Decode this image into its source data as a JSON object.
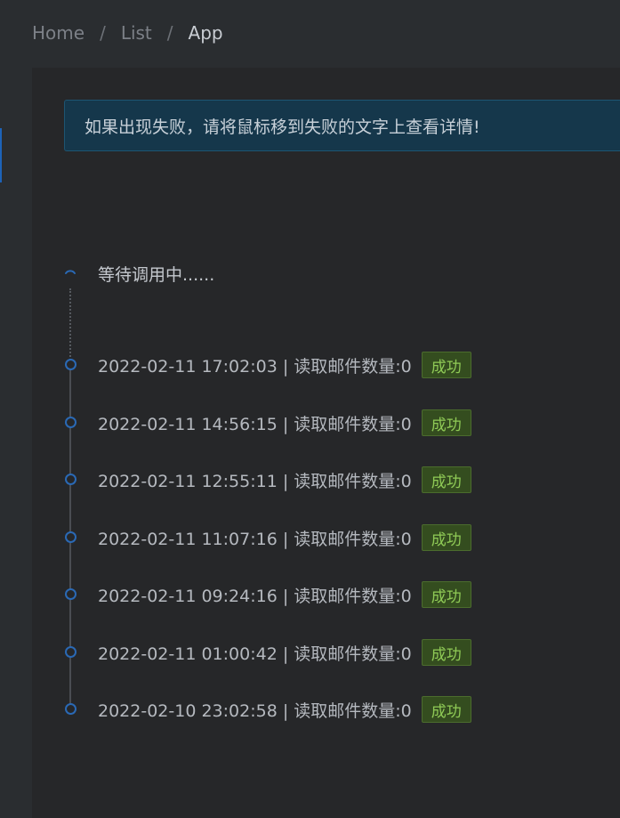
{
  "breadcrumb": {
    "items": [
      {
        "label": "Home"
      },
      {
        "label": "List"
      },
      {
        "label": "App"
      }
    ],
    "separator": "/"
  },
  "alert": {
    "message": "如果出现失败，请将鼠标移到失败的文字上查看详情!"
  },
  "timeline": {
    "pending_label": "等待调用中......",
    "entries": [
      {
        "text": "2022-02-11 17:02:03 |  读取邮件数量:0",
        "status": "成功"
      },
      {
        "text": "2022-02-11 14:56:15 |  读取邮件数量:0",
        "status": "成功"
      },
      {
        "text": "2022-02-11 12:55:11 |  读取邮件数量:0",
        "status": "成功"
      },
      {
        "text": "2022-02-11 11:07:16 |  读取邮件数量:0",
        "status": "成功"
      },
      {
        "text": "2022-02-11 09:24:16 |  读取邮件数量:0",
        "status": "成功"
      },
      {
        "text": "2022-02-11 01:00:42 |  读取邮件数量:0",
        "status": "成功"
      },
      {
        "text": "2022-02-10 23:02:58 |  读取邮件数量:0",
        "status": "成功"
      }
    ]
  },
  "colors": {
    "accent": "#1d63b8",
    "success_text": "#8fca56",
    "success_bg": "#344d1f",
    "alert_bg": "#15374b"
  }
}
